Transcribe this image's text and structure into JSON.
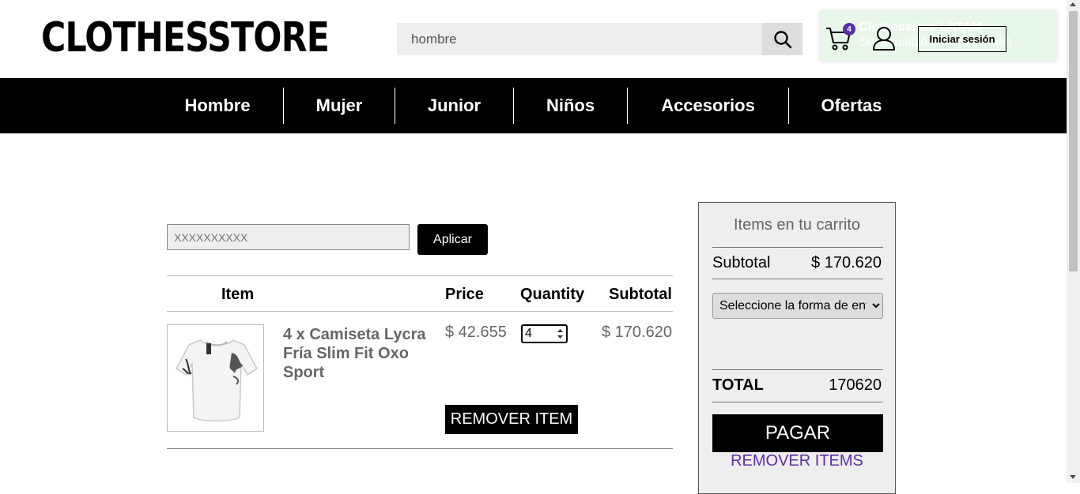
{
  "header": {
    "logo": "CLOTHESSTORE",
    "search_value": "hombre",
    "search_icon": "search-icon",
    "cart_count": "4",
    "cart_icon": "cart-icon",
    "user_icon": "user-icon",
    "login_label": "Iniciar sesión"
  },
  "toast": {
    "line1": "Clothesstore LATAM",
    "line2": "Se actualizó el departamen"
  },
  "nav": {
    "items": [
      "Hombre",
      "Mujer",
      "Junior",
      "Niños",
      "Accesorios",
      "Ofertas"
    ]
  },
  "coupon": {
    "placeholder": "XXXXXXXXXX",
    "apply_label": "Aplicar"
  },
  "cart_table": {
    "headers": [
      "Item",
      "Price",
      "Quantity",
      "Subtotal"
    ],
    "rows": [
      {
        "name": "4 x Camiseta Lycra Fría Slim Fit Oxo Sport",
        "price": "$ 42.655",
        "quantity": "4",
        "subtotal": "$ 170.620",
        "remove_label": "REMOVER ITEM",
        "image_icon": "tshirt-icon"
      }
    ]
  },
  "summary": {
    "title": "Items en tu carrito",
    "subtotal_label": "Subtotal",
    "subtotal_value": "$ 170.620",
    "delivery_selected": "Seleccione la forma de entrega",
    "total_label": "TOTAL",
    "total_value": "170620",
    "pay_label": "PAGAR",
    "remove_all_label": "REMOVER ITEMS"
  },
  "colors": {
    "accent": "#5b2fa6",
    "nav_bg": "#000000",
    "toast_bg": "#e9f7ea"
  }
}
